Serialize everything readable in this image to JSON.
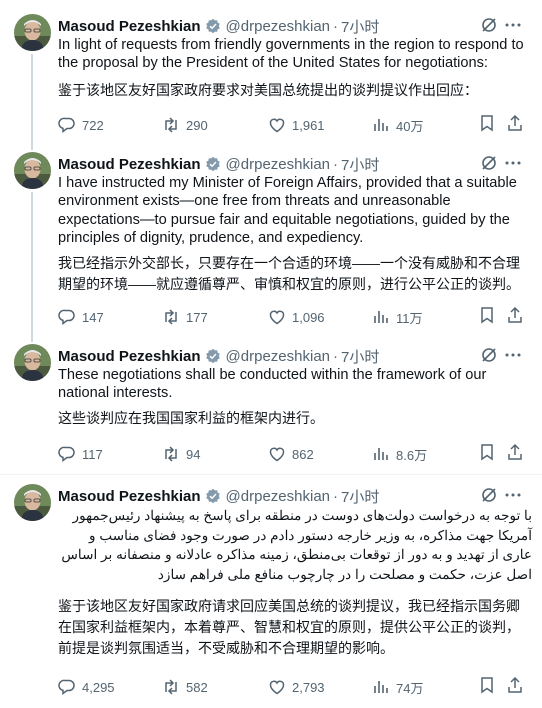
{
  "author": {
    "name": "Masoud Pezeshkian",
    "handle": "@drpezeshkian",
    "verified_color": "#829aab"
  },
  "colors": {
    "text": "#0f1419",
    "muted": "#536471",
    "divider": "#eff3f4"
  },
  "posts": [
    {
      "time": "7小时",
      "paragraphs": [
        "In light of requests from friendly governments in the region to respond to the proposal by the President of the United States for negotiations:",
        "鉴于该地区友好国家政府要求对美国总统提出的谈判提议作出回应："
      ],
      "replies": "722",
      "reposts": "290",
      "likes": "1,961",
      "views": "40万"
    },
    {
      "time": "7小时",
      "paragraphs": [
        "I have instructed my Minister of Foreign Affairs, provided that a suitable environment exists—one free from threats and unreasonable expectations—to pursue fair and equitable negotiations, guided by the principles of dignity, prudence, and expediency.",
        "我已经指示外交部长，只要存在一个合适的环境——一个没有威胁和不合理期望的环境——就应遵循尊严、审慎和权宜的原则，进行公平公正的谈判。"
      ],
      "replies": "147",
      "reposts": "177",
      "likes": "1,096",
      "views": "11万"
    },
    {
      "time": "7小时",
      "paragraphs": [
        "These negotiations shall be conducted within the framework of our national interests.",
        "这些谈判应在我国国家利益的框架内进行。"
      ],
      "replies": "117",
      "reposts": "94",
      "likes": "862",
      "views": "8.6万"
    },
    {
      "time": "7小时",
      "paragraphs": [
        "با توجه به درخواست دولت‌های دوست در منطقه برای پاسخ به پیشنهاد رئیس‌جمهور آمریکا جهت مذاکره، به وزیر خارجه دستور دادم در صورت وجود فضای مناسب و عاری از تهدید و به دور از توقعات بی‌منطق، زمینه مذاکره عادلانه و منصفانه بر اساس اصل عزت، حکمت و مصلحت را در چارچوب منافع ملی فراهم سازد",
        "鉴于该地区友好国家政府请求回应美国总统的谈判提议，我已经指示国务卿在国家利益框架内，本着尊严、智慧和权宜的原则，提供公平公正的谈判，前提是谈判氛围适当，不受威胁和不合理期望的影响。"
      ],
      "replies": "4,295",
      "reposts": "582",
      "likes": "2,793",
      "views": "74万"
    }
  ]
}
